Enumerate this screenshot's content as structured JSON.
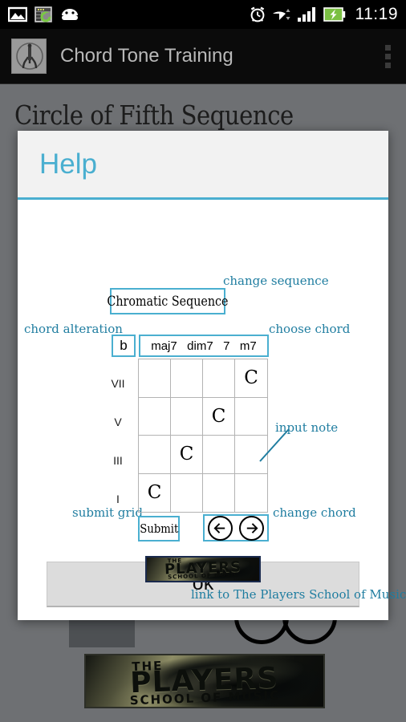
{
  "statusbar": {
    "icons": [
      "image-icon",
      "app-update-icon",
      "android-robot-icon",
      "alarm-icon",
      "wifi-icon",
      "signal-bars-icon",
      "battery-charging-icon"
    ],
    "time": "11:19"
  },
  "actionbar": {
    "app_icon": "chord-tone-app-icon",
    "title": "Chord Tone Training",
    "overflow_icon": "overflow-menu-icon"
  },
  "background": {
    "page_title": "Circle of Fifth Sequence",
    "banner": {
      "line1": "THE",
      "line2": "PLAYERS",
      "line3": "SCHOOL OF MUSIC"
    }
  },
  "dialog": {
    "title": "Help",
    "annotations": {
      "change_sequence": "change sequence",
      "chord_alteration": "chord alteration",
      "choose_chord": "choose chord",
      "input_note": "input note",
      "submit_grid": "submit grid",
      "change_chord": "change chord",
      "link_label": "link to The Players School of Music"
    },
    "sequence_button": "Chromatic Sequence",
    "alteration_button": "b",
    "chord_options": [
      "maj7",
      "dim7",
      "7",
      "m7"
    ],
    "grid": {
      "row_labels": [
        "VII",
        "V",
        "III",
        "I"
      ],
      "cells": [
        [
          "",
          "",
          "",
          "C"
        ],
        [
          "",
          "",
          "C",
          ""
        ],
        [
          "",
          "C",
          "",
          ""
        ],
        [
          "C",
          "",
          "",
          ""
        ]
      ]
    },
    "submit_button": "Submit",
    "prev_icon": "arrow-left-circle-icon",
    "next_icon": "arrow-right-circle-icon",
    "banner": {
      "line1": "THE",
      "line2": "PLAYERS",
      "line3": "SCHOOL OF MUSIC"
    },
    "ok_button": "ok"
  },
  "colors": {
    "accent_teal": "#4aafd0",
    "annotation_blue": "#1f7da0",
    "status_bar": "#000000",
    "action_bar": "#0b0b0b",
    "app_background": "#6e7073",
    "battery_green": "#7bc043"
  }
}
